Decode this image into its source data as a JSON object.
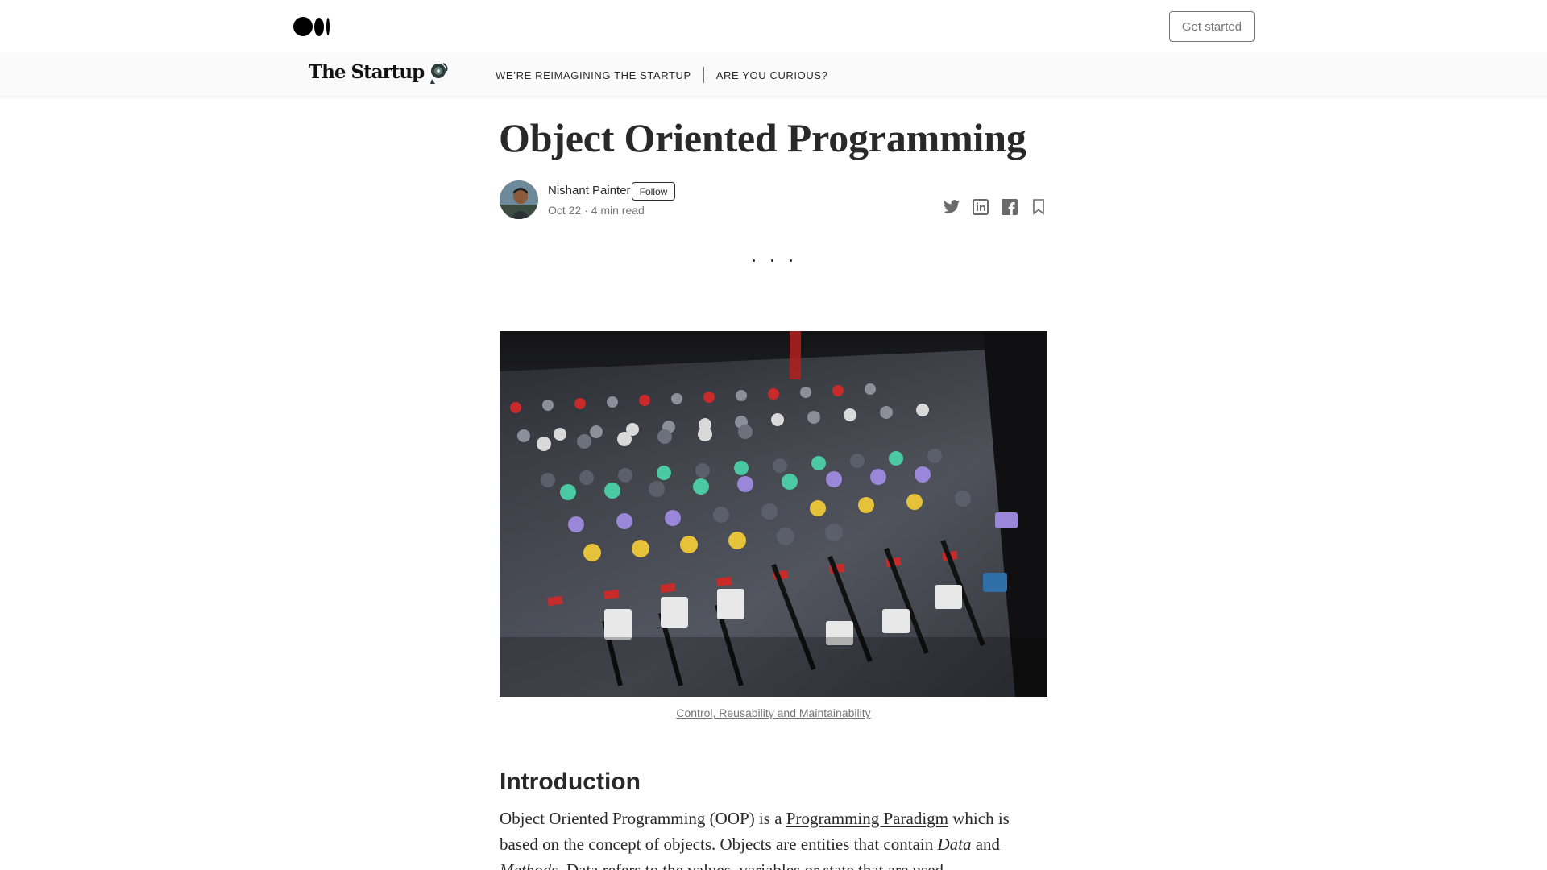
{
  "topbar": {
    "get_started": "Get started"
  },
  "publication": {
    "name": "The Startup",
    "nav": [
      "WE’RE REIMAGINING THE STARTUP",
      "ARE YOU CURIOUS?"
    ]
  },
  "article": {
    "title": "Object Oriented Programming",
    "author": "Nishant Painter",
    "follow": "Follow",
    "meta": "Oct 22 · 4 min read",
    "caption": "Control, Reusability and Maintainability",
    "section_heading": "Introduction",
    "body": {
      "p1": "Object Oriented Programming (OOP) is a ",
      "link": "Programming Paradigm",
      "p2": " which is based on the concept of objects. Objects are entities that contain ",
      "em1": "Data",
      "p3": " and ",
      "em2": "Methods",
      "p4": ". Data refers to the values, variables or state that are used"
    }
  },
  "share_icons": [
    "twitter-icon",
    "linkedin-icon",
    "facebook-icon",
    "bookmark-icon"
  ]
}
